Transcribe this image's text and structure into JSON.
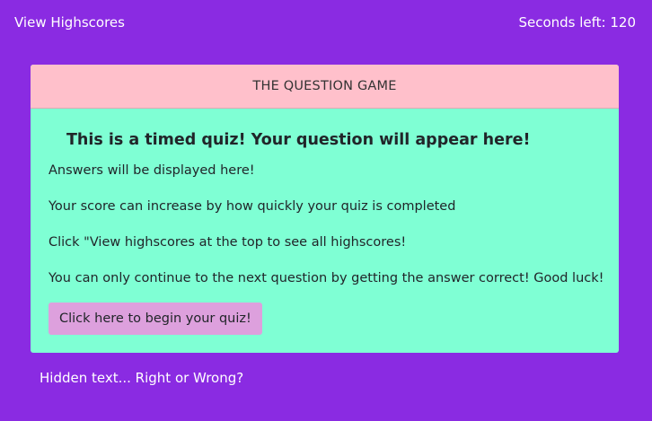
{
  "topbar": {
    "view_highscores": "View Highscores",
    "timer_label": "Seconds left: 120"
  },
  "card": {
    "header_title": "THE QUESTION GAME",
    "question": "This is a timed quiz! Your question will appear here!",
    "lines": [
      "Answers will be displayed here!",
      "Your score can increase by how quickly your quiz is completed",
      "Click \"View highscores at the top to see all highscores!",
      "You can only continue to the next question by getting the answer correct! Good luck!"
    ],
    "begin_button": "Click here to begin your quiz!"
  },
  "footer": {
    "hidden_text": "Hidden text... Right or Wrong?"
  },
  "colors": {
    "background": "#8a2be2",
    "header": "#ffc0cb",
    "card_body": "#7fffd4",
    "button": "#dda0dd"
  }
}
